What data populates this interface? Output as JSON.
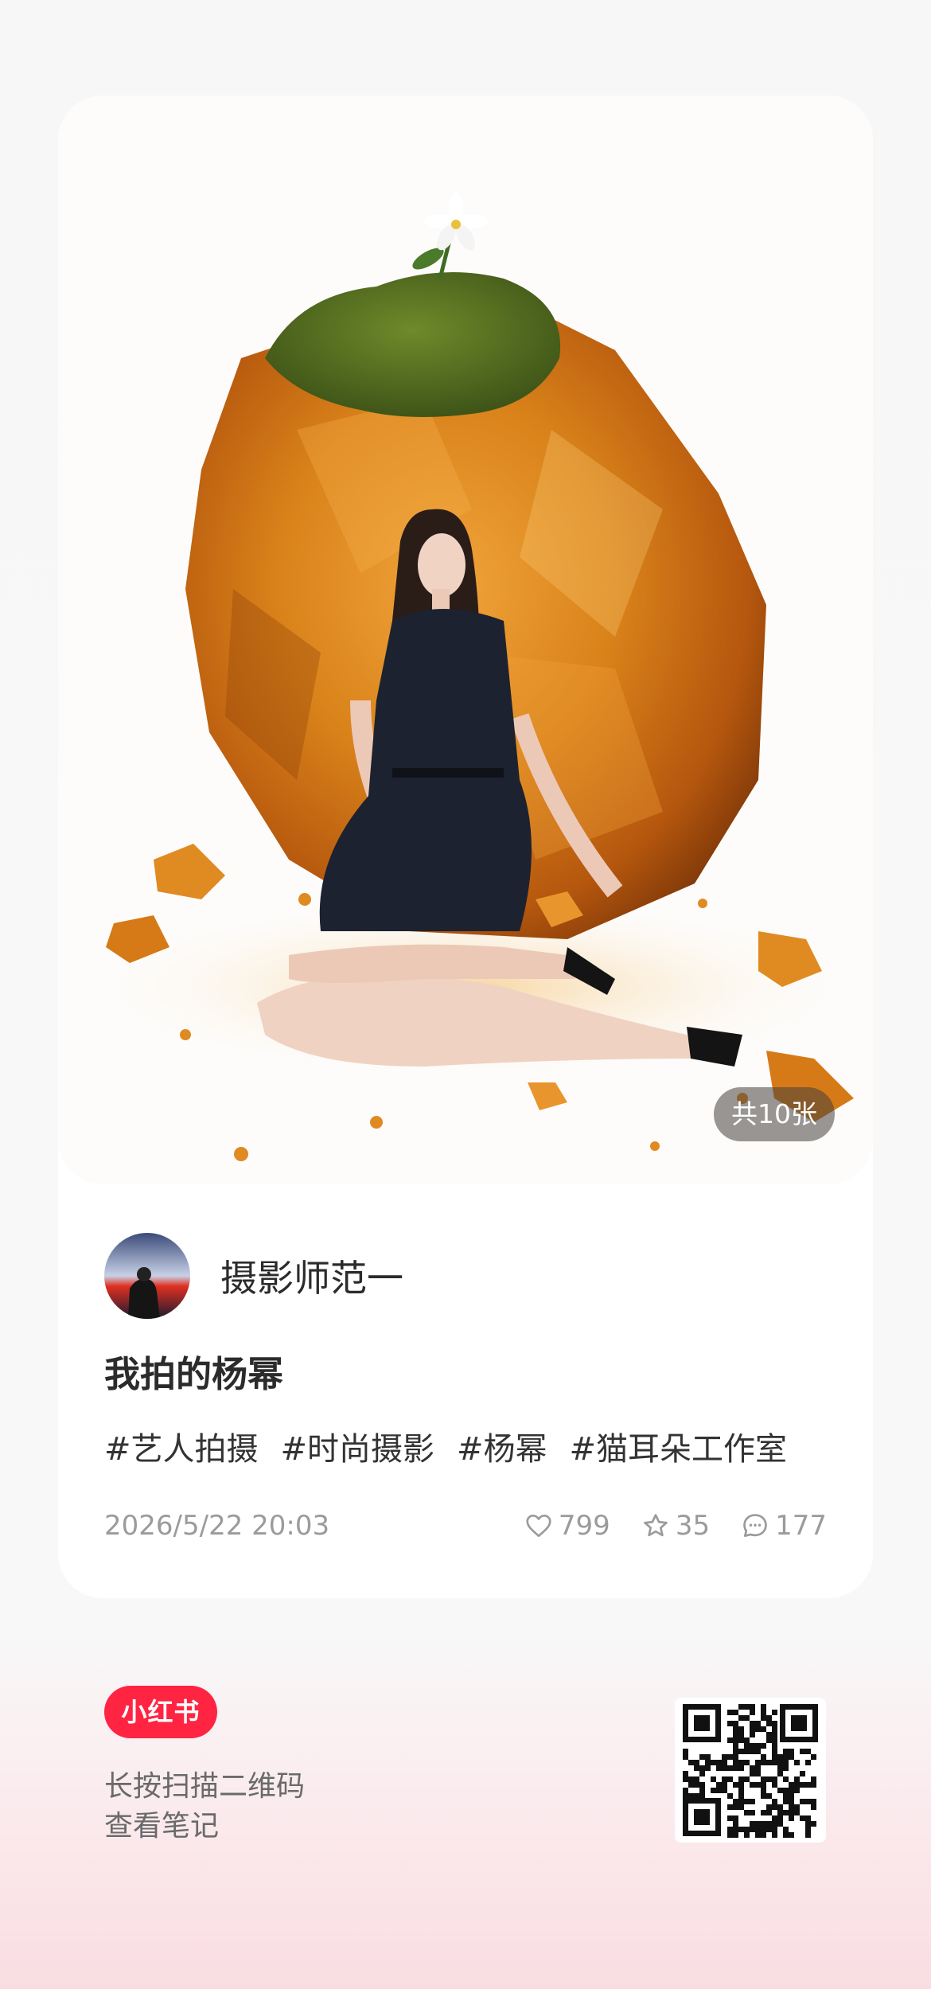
{
  "card": {
    "image_count_label": "共10张",
    "author": {
      "name": "摄影师范一"
    },
    "title": "我拍的杨幂",
    "tags": [
      "#艺人拍摄",
      "#时尚摄影",
      "#杨幂",
      "#猫耳朵工作室"
    ],
    "datetime": "2026/5/22 20:03",
    "stats": {
      "likes": "799",
      "favorites": "35",
      "comments": "177"
    }
  },
  "footer": {
    "brand": "小红书",
    "line1": "长按扫描二维码",
    "line2": "查看笔记"
  },
  "colors": {
    "brand_red": "#ff2442",
    "amber": "#d9821a",
    "moss": "#4f6b1e"
  },
  "icons": {
    "likes": "heart-icon",
    "favorites": "star-icon",
    "comments": "comment-icon"
  }
}
